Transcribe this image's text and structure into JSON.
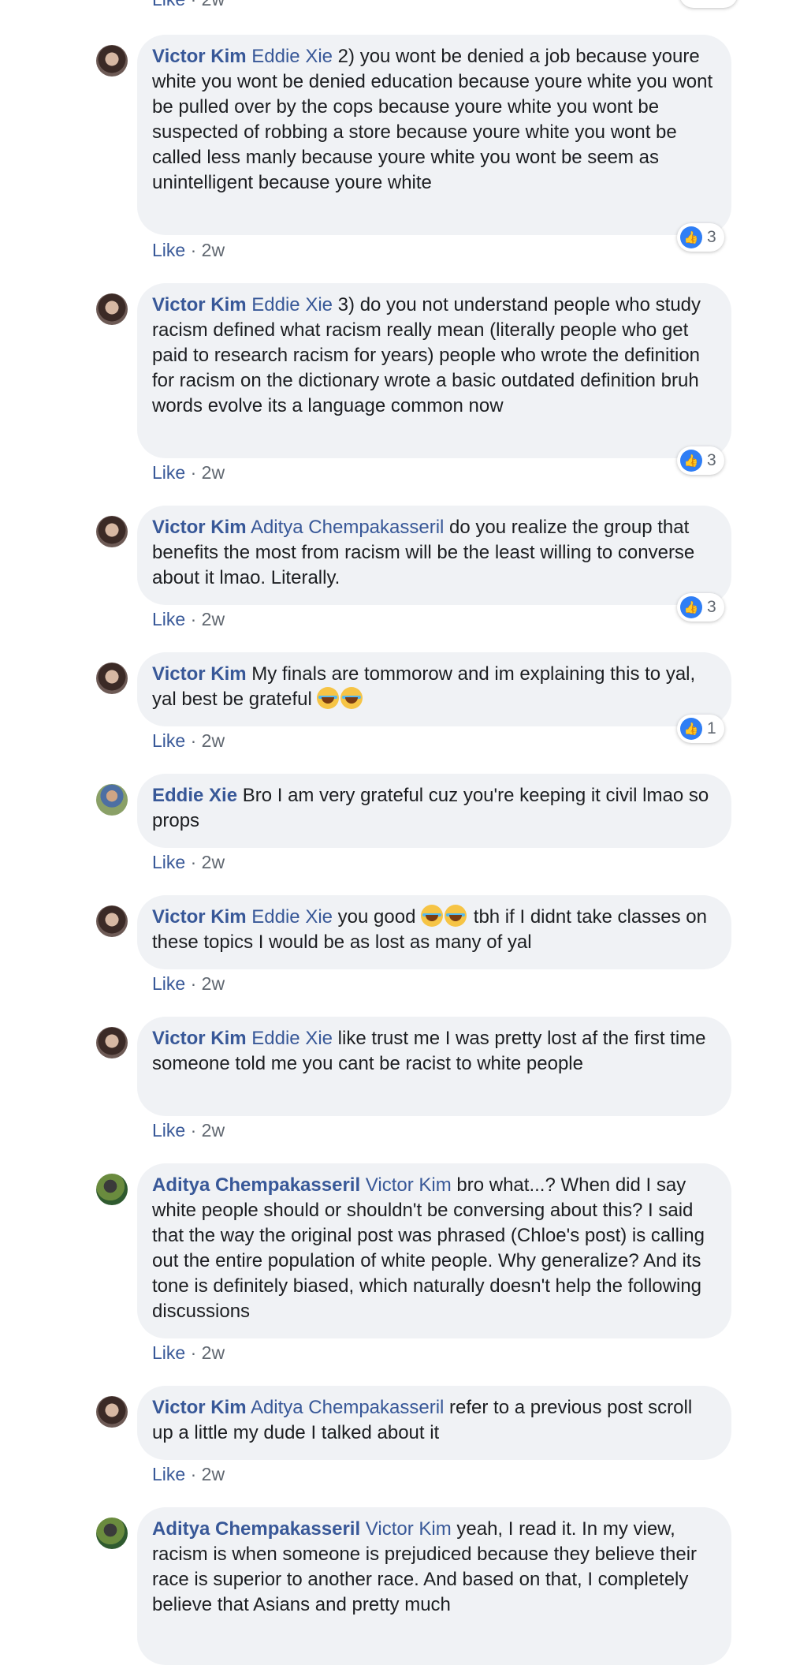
{
  "top_action": {
    "like": "Like",
    "sep": " · ",
    "time": "2w"
  },
  "comments": [
    {
      "author": "Victor Kim",
      "mention": "Eddie Xie",
      "text": " 2) you wont be denied a job because youre white you wont be denied education because youre white you wont be pulled over by the cops because youre white you wont be suspected of robbing a store because youre white you wont be called less manly because youre white you wont be seem as unintelligent because youre white",
      "like": "Like",
      "sep": " · ",
      "time": "2w",
      "reaction_count": "3"
    },
    {
      "author": "Victor Kim",
      "mention": "Eddie Xie",
      "text": " 3) do you not understand people who study racism defined what racism really mean (literally people who get paid to research racism for years) people who wrote the definition for racism on the dictionary wrote a basic outdated definition bruh words evolve its a language common now",
      "like": "Like",
      "sep": " · ",
      "time": "2w",
      "reaction_count": "3"
    },
    {
      "author": "Victor Kim",
      "mention": "Aditya Chempakasseril",
      "text": " do you realize the group that benefits the most from racism will be the least willing to converse about it lmao. Literally.",
      "like": "Like",
      "sep": " · ",
      "time": "2w",
      "reaction_count": "3"
    },
    {
      "author": "Victor Kim",
      "text": " My finals are tommorow and im explaining this to yal, yal best be grateful ",
      "emoji": "tears-of-joy",
      "like": "Like",
      "sep": " · ",
      "time": "2w",
      "reaction_count": "1"
    },
    {
      "author": "Eddie Xie",
      "text": " Bro I am very grateful cuz you're keeping it civil lmao so props",
      "like": "Like",
      "sep": " · ",
      "time": "2w"
    },
    {
      "author": "Victor Kim",
      "mention": "Eddie Xie",
      "text": " you good ",
      "text_after": " tbh if I didnt take classes on these topics I would be as lost as many of yal",
      "like": "Like",
      "sep": " · ",
      "time": "2w"
    },
    {
      "author": "Victor Kim",
      "mention": "Eddie Xie",
      "text": " like trust me I was pretty lost af the first time someone told me you cant be racist to white people",
      "like": "Like",
      "sep": " · ",
      "time": "2w"
    },
    {
      "author": "Aditya Chempakasseril",
      "mention": "Victor Kim",
      "text": " bro what...? When did I say white people should or shouldn't be conversing about this? I said that the way the original post was phrased (Chloe's post) is calling out the entire population of white people. Why generalize? And its tone is definitely biased, which naturally doesn't help the following discussions",
      "like": "Like",
      "sep": " · ",
      "time": "2w"
    },
    {
      "author": "Victor Kim",
      "mention": "Aditya Chempakasseril",
      "text": " refer to a previous post scroll up a little my dude I talked about it",
      "like": "Like",
      "sep": " · ",
      "time": "2w"
    },
    {
      "author": "Aditya Chempakasseril",
      "mention": "Victor Kim",
      "text": " yeah, I read it. In my view, racism is when someone is prejudiced because they believe their race is superior to another race. And based on that, I completely believe that Asians and pretty much"
    }
  ],
  "icons": {
    "reaction": "like-thumb-icon",
    "emoji": "tears-of-joy-icon"
  },
  "colors": {
    "link": "#385898",
    "bubble": "#f0f2f5",
    "reaction": "#2f7ef5"
  }
}
